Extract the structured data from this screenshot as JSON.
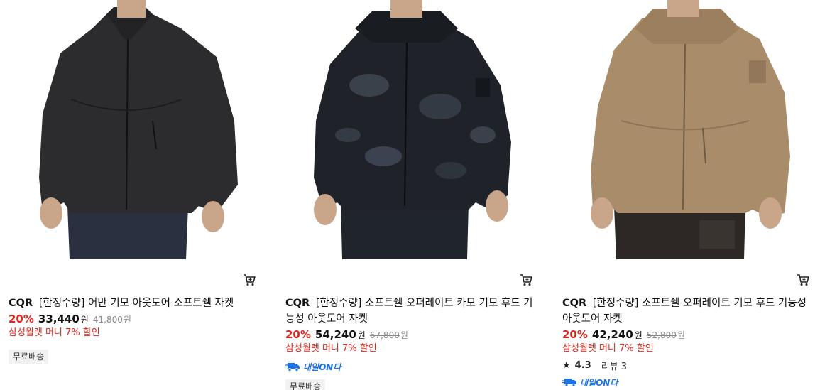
{
  "products": [
    {
      "brand": "CQR",
      "name": "[한정수량] 어반 기모 아웃도어 소프트쉘 자켓",
      "discount": "20%",
      "price": "33,440",
      "price_unit": "원",
      "original_price": "41,800",
      "original_unit": "원",
      "promo": "삼성월렛 머니 7% 할인",
      "badge": "무료배송",
      "jacket_color": "#2c2c2e"
    },
    {
      "brand": "CQR",
      "name": "[한정수량] 소프트쉘 오퍼레이트 카모 기모 후드 기능성 아웃도어 자켓",
      "discount": "20%",
      "price": "54,240",
      "price_unit": "원",
      "original_price": "67,800",
      "original_unit": "원",
      "promo": "삼성월렛 머니 7% 할인",
      "delivery": "내일ON다",
      "badge": "무료배송",
      "jacket_color": "#1f2329"
    },
    {
      "brand": "CQR",
      "name": "[한정수량] 소프트쉘 오퍼레이트 기모 후드 기능성 아웃도어 자켓",
      "discount": "20%",
      "price": "42,240",
      "price_unit": "원",
      "original_price": "52,800",
      "original_unit": "원",
      "promo": "삼성월렛 머니 7% 할인",
      "rating": "4.3",
      "reviews": "리뷰 3",
      "delivery": "내일ON다",
      "jacket_color": "#a98c6a"
    }
  ],
  "icons": {
    "cart": "cart-icon",
    "star": "star-icon",
    "truck": "truck-icon"
  },
  "colors": {
    "discount_red": "#e0241b",
    "delivery_blue": "#1a73e8",
    "badge_bg": "#f1f1f1"
  }
}
